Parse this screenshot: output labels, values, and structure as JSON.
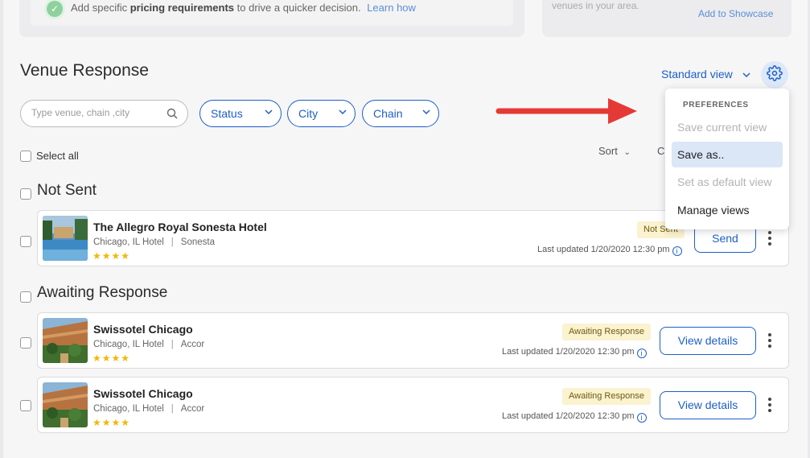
{
  "tip_card": {
    "text_pre": "Add specific",
    "text_bold": "pricing requirements",
    "text_post": "to drive a quicker decision.",
    "link": "Learn how"
  },
  "showcase_card": {
    "text": "venues in your area.",
    "link": "Add to Showcase"
  },
  "header": {
    "title": "Venue Response",
    "view_label": "Standard view"
  },
  "filters": {
    "search_placeholder": "Type venue, chain ,city",
    "pills": [
      "Status",
      "City",
      "Chain"
    ]
  },
  "toolbar": {
    "select_all": "Select all",
    "sort": "Sort",
    "customize_partial": "Cu"
  },
  "preferences_menu": {
    "header": "PREFERENCES",
    "items": [
      {
        "label": "Save current view",
        "state": "disabled"
      },
      {
        "label": "Save as..",
        "state": "active"
      },
      {
        "label": "Set as default view",
        "state": "disabled"
      },
      {
        "label": "Manage views",
        "state": "normal"
      }
    ]
  },
  "groups": [
    {
      "title": "Not Sent",
      "venues": [
        {
          "name": "The Allegro Royal Sonesta Hotel",
          "location": "Chicago, IL Hotel",
          "brand": "Sonesta",
          "stars": "★★★★",
          "status": "Not Sent",
          "updated": "Last updated 1/20/2020 12:30 pm",
          "action": "Send"
        }
      ]
    },
    {
      "title": "Awaiting Response",
      "venues": [
        {
          "name": "Swissotel Chicago",
          "location": "Chicago, IL Hotel",
          "brand": "Accor",
          "stars": "★★★★",
          "status": "Awaiting Response",
          "updated": "Last updated 1/20/2020 12:30 pm",
          "action": "View details"
        },
        {
          "name": "Swissotel Chicago",
          "location": "Chicago, IL Hotel",
          "brand": "Accor",
          "stars": "★★★★",
          "status": "Awaiting Response",
          "updated": "Last updated 1/20/2020 12:30 pm",
          "action": "View details"
        }
      ]
    }
  ],
  "colors": {
    "accent": "#1d5fc8",
    "arrow": "#e53935",
    "badge_bg": "#fbf2cf",
    "star": "#f2b705"
  }
}
